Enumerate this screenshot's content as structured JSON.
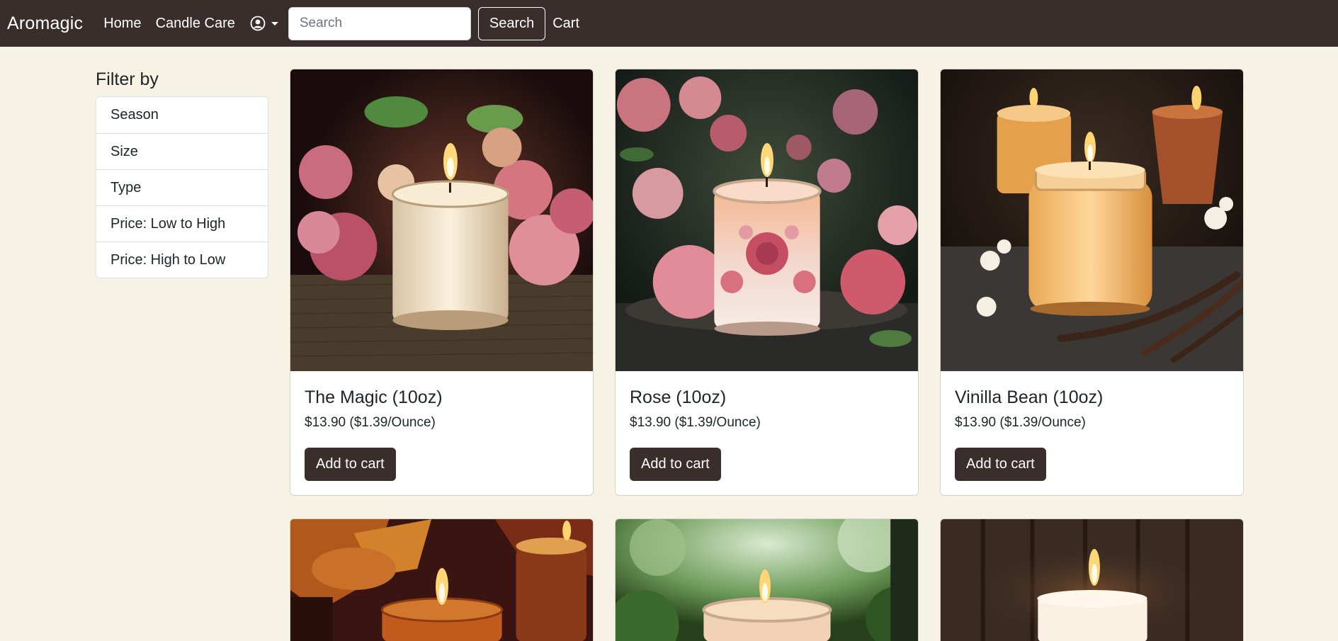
{
  "navbar": {
    "brand": "Aromagic",
    "links": [
      "Home",
      "Candle Care"
    ],
    "user_icon": "user-circle-icon",
    "search_placeholder": "Search",
    "search_value": "",
    "search_button": "Search",
    "cart": "Cart"
  },
  "filter": {
    "title": "Filter by",
    "items": [
      "Season",
      "Size",
      "Type",
      "Price: Low to High",
      "Price: High to Low"
    ]
  },
  "products": [
    {
      "name": "The Magic (10oz)",
      "price": "$13.90 ($1.39/Ounce)",
      "button": "Add to cart",
      "image": "candle-with-pink-roses"
    },
    {
      "name": "Rose (10oz)",
      "price": "$13.90 ($1.39/Ounce)",
      "button": "Add to cart",
      "image": "rose-print-candle-with-roses"
    },
    {
      "name": "Vinilla Bean (10oz)",
      "price": "$13.90 ($1.39/Ounce)",
      "button": "Add to cart",
      "image": "vanilla-candle-with-vanilla-pods"
    },
    {
      "name": "",
      "price": "",
      "button": "",
      "image": "amber-candle-autumn-leaves"
    },
    {
      "name": "",
      "price": "",
      "button": "",
      "image": "candle-garden-greenery"
    },
    {
      "name": "",
      "price": "",
      "button": "",
      "image": "pillar-candle-dark-wood"
    }
  ],
  "colors": {
    "navbar": "#3a2e2d",
    "page_background": "#f7f3e4",
    "button": "#3a2e2d"
  }
}
